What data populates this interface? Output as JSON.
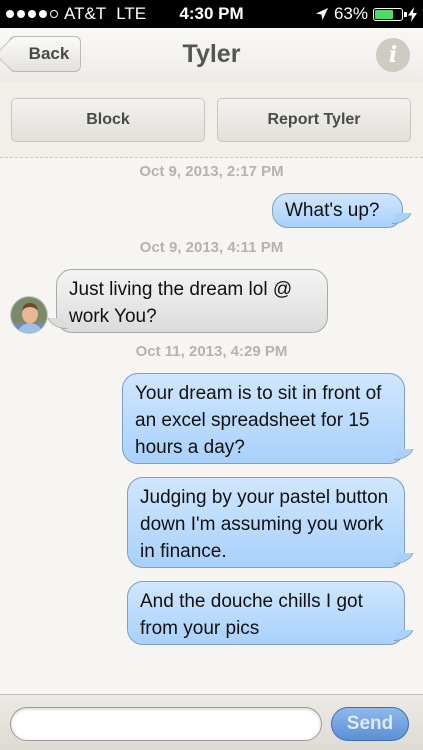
{
  "status_bar": {
    "carrier": "AT&T",
    "network": "LTE",
    "time": "4:30 PM",
    "battery_percent": "63%",
    "battery_level": 0.63,
    "signal_bars": 4
  },
  "nav": {
    "back_label": "Back",
    "title": "Tyler",
    "info_icon": "info-icon"
  },
  "actions": {
    "block_label": "Block",
    "report_label": "Report Tyler"
  },
  "conversation": {
    "timestamps": [
      "Oct 9, 2013, 2:17 PM",
      "Oct 9, 2013, 4:11 PM",
      "Oct 11, 2013, 4:29 PM"
    ],
    "messages": [
      {
        "direction": "out",
        "text": "What's up?"
      },
      {
        "direction": "in",
        "text": "Just living the dream lol @ work You?"
      },
      {
        "direction": "out",
        "text": "Your dream is to sit in front of an excel spreadsheet for 15 hours a day?"
      },
      {
        "direction": "out",
        "text": "Judging by your pastel button down I'm assuming you work in finance."
      },
      {
        "direction": "out",
        "text": "And the douche chills I got from your pics"
      }
    ]
  },
  "compose": {
    "placeholder": "",
    "send_label": "Send"
  },
  "colors": {
    "outgoing_bubble": "#a9d1fb",
    "incoming_bubble": "#dcdcdc",
    "send_button": "#5b8fd4",
    "battery_fill": "#4cd964"
  }
}
